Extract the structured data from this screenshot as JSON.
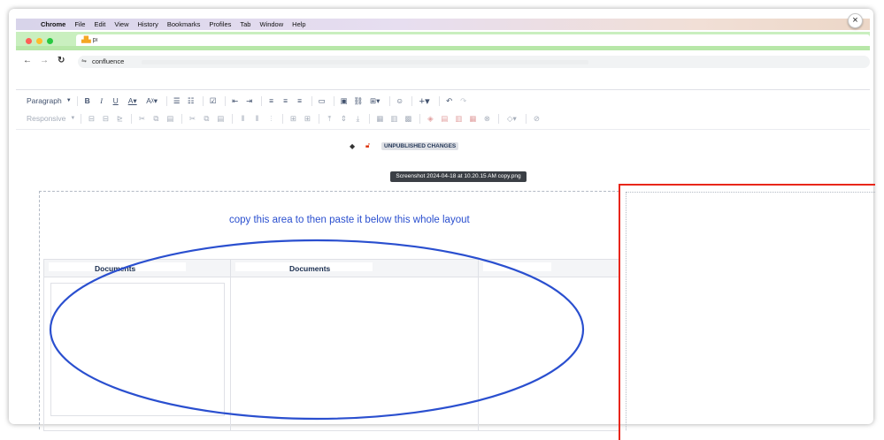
{
  "menubar": {
    "items": [
      "Chrome",
      "File",
      "Edit",
      "View",
      "History",
      "Bookmarks",
      "Profiles",
      "Tab",
      "Window",
      "Help"
    ]
  },
  "tab": {
    "title": "pı"
  },
  "urlbar": {
    "value": "confluence"
  },
  "toolbar": {
    "paragraph_label": "Paragraph",
    "responsive_label": "Responsive"
  },
  "status": {
    "badge": "UNPUBLISHED CHANGES"
  },
  "tooltip": {
    "text": "Screenshot 2024-04-18 at 10.20.15 AM copy.png"
  },
  "content": {
    "instruction": "copy this area to then paste it below this whole layout",
    "table": {
      "headers": [
        "Documents",
        "Documents",
        ""
      ]
    }
  },
  "colors": {
    "annotation_blue": "#2a4fcf",
    "annotation_red": "#e8261a",
    "tab_green": "#c9efbf"
  }
}
